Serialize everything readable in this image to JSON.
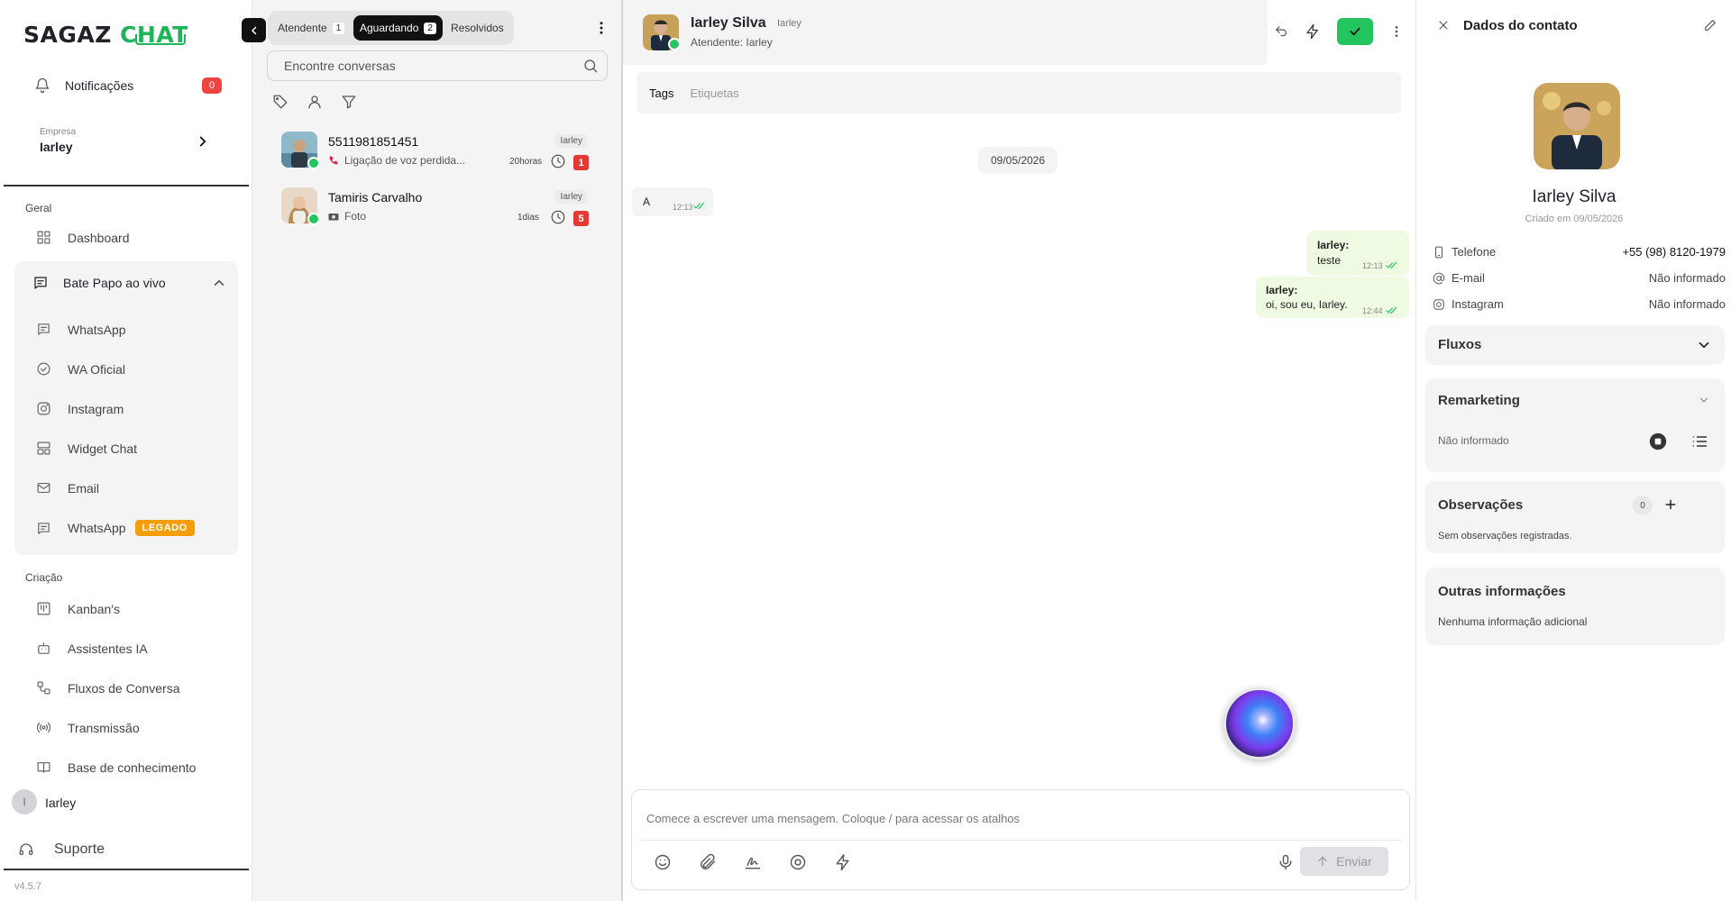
{
  "brand": {
    "part1": "SAGAZ",
    "part2": "CHAT"
  },
  "sidebar": {
    "notifications": {
      "label": "Notificações",
      "count": "0"
    },
    "company": {
      "label": "Empresa",
      "value": "Iarley"
    },
    "section_geral": "Geral",
    "dashboard": "Dashboard",
    "live_chat": {
      "label": "Bate Papo ao vivo",
      "items": [
        "WhatsApp",
        "WA Oficial",
        "Instagram",
        "Widget Chat",
        "Email",
        "WhatsApp"
      ],
      "legacy_badge": "LEGADO"
    },
    "section_criacao": "Criação",
    "creation_items": [
      "Kanban's",
      "Assistentes IA",
      "Fluxos de Conversa",
      "Transmissão",
      "Base de conhecimento"
    ],
    "user": {
      "initial": "I",
      "name": "Iarley"
    },
    "support": "Suporte",
    "version": "v4.5.7"
  },
  "conversations": {
    "tabs": [
      {
        "label": "Atendente",
        "count": "1"
      },
      {
        "label": "Aguardando",
        "count": "2"
      },
      {
        "label": "Resolvidos",
        "count": ""
      }
    ],
    "search_placeholder": "Encontre conversas",
    "items": [
      {
        "name": "5511981851451",
        "preview": "Ligação de voz perdida...",
        "agent": "Iarley",
        "time": "20horas",
        "unread": "1"
      },
      {
        "name": "Tamiris Carvalho",
        "preview": "Foto",
        "agent": "Iarley",
        "time": "1dias",
        "unread": "5"
      }
    ]
  },
  "chat": {
    "contact_name": "Iarley Silva",
    "contact_user": "Iarley",
    "attendant": "Atendente: Iarley",
    "tags_tab": "Tags",
    "labels_tab": "Etiquetas",
    "date_chip": "09/05/2026",
    "messages": [
      {
        "dir": "in",
        "text": "A",
        "time": "12:13"
      },
      {
        "dir": "out",
        "sender": "Iarley:",
        "text": "teste",
        "time": "12:13"
      },
      {
        "dir": "out",
        "sender": "Iarley:",
        "text": "oi, sou eu, Iarley.",
        "time": "12:44"
      }
    ],
    "composer_placeholder": "Comece a escrever uma mensagem. Coloque / para acessar os atalhos",
    "send_label": "Enviar"
  },
  "contact_panel": {
    "title": "Dados do contato",
    "name": "Iarley Silva",
    "created": "Criado em 09/05/2026",
    "phone": {
      "label": "Telefone",
      "value": "+55 (98) 8120-1979"
    },
    "email": {
      "label": "E-mail",
      "value": "Não informado"
    },
    "instagram": {
      "label": "Instagram",
      "value": "Não informado"
    },
    "fluxos": "Fluxos",
    "remarketing": {
      "title": "Remarketing",
      "value": "Não informado"
    },
    "observacoes": {
      "title": "Observações",
      "count": "0",
      "empty": "Sem observações registradas."
    },
    "outras": {
      "title": "Outras informações",
      "empty": "Nenhuma informação adicional"
    }
  },
  "colors": {
    "accent": "#1fb35a",
    "resolve": "#22c55e",
    "badge_red": "#e53935",
    "legacy": "#f59e0b"
  }
}
